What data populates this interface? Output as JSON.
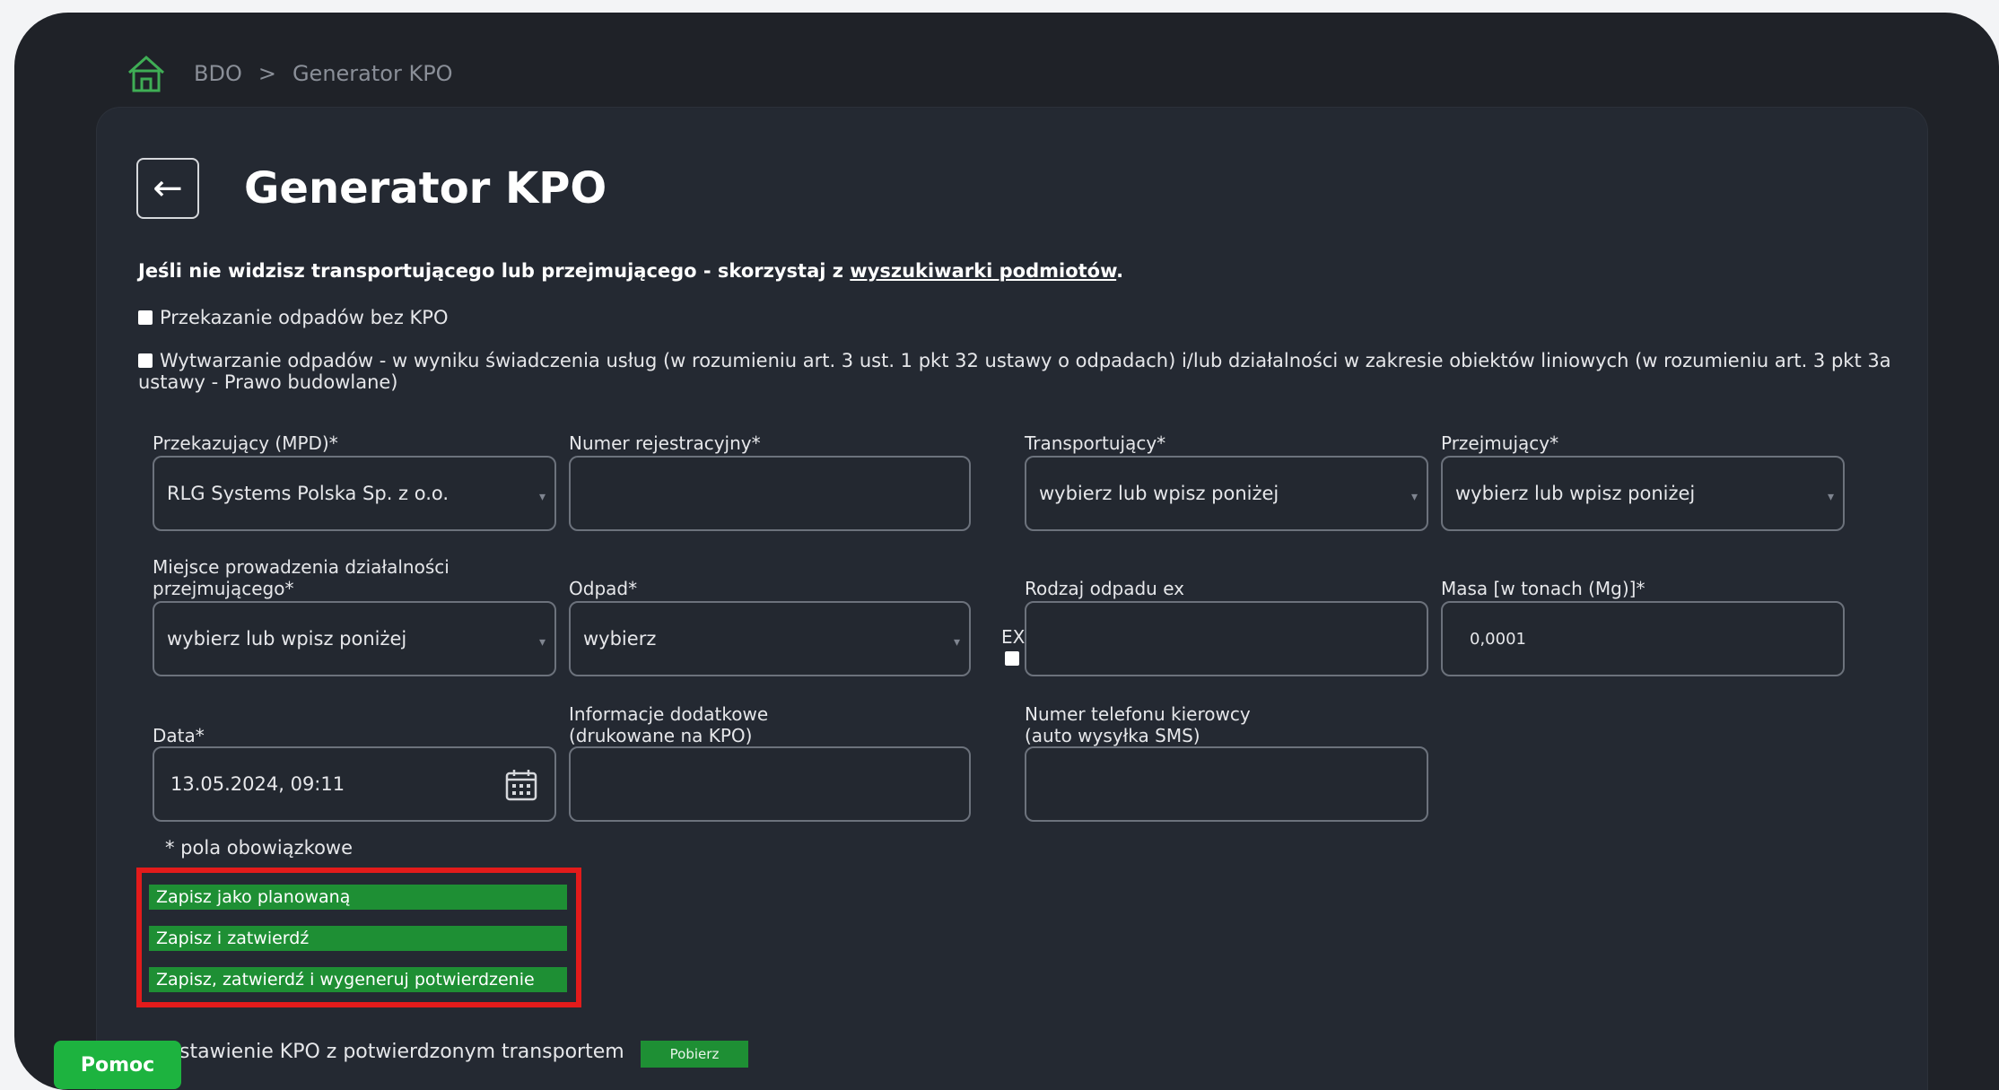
{
  "breadcrumb": {
    "root": "BDO",
    "separator": ">",
    "current": "Generator KPO"
  },
  "page": {
    "title": "Generator KPO",
    "info_prefix": "Jeśli nie widzisz transportującego lub przejmującego - skorzystaj z ",
    "info_link": "wyszukiwarki podmiotów",
    "info_suffix": ".",
    "checkbox1": "Przekazanie odpadów bez KPO",
    "checkbox2": "Wytwarzanie odpadów - w wyniku świadczenia usług (w rozumieniu art. 3 ust. 1 pkt 32 ustawy o odpadach) i/lub działalności w zakresie obiektów liniowych (w rozumieniu art. 3 pkt 3a ustawy - Prawo budowlane)"
  },
  "form": {
    "przekazujacy_label": "Przekazujący (MPD)*",
    "przekazujacy_value": "RLG Systems Polska Sp. z o.o.",
    "numer_rej_label": "Numer rejestracyjny*",
    "transportujacy_label": "Transportujący*",
    "transportujacy_value": "wybierz lub wpisz poniżej",
    "przejmujacy_label": "Przejmujący*",
    "przejmujacy_value": "wybierz lub wpisz poniżej",
    "miejsce_label_1": "Miejsce prowadzenia działalności",
    "miejsce_label_2": "przejmującego*",
    "miejsce_value": "wybierz lub wpisz poniżej",
    "odpad_label": "Odpad*",
    "odpad_value": "wybierz",
    "ex_label": "EX",
    "rodzaj_label": "Rodzaj odpadu ex",
    "masa_label": "Masa [w tonach (Mg)]*",
    "masa_value": "0,0001",
    "data_label": "Data*",
    "data_value": "13.05.2024, 09:11",
    "info_dod_label_1": "Informacje dodatkowe",
    "info_dod_label_2": "(drukowane na KPO)",
    "telefon_label_1": "Numer telefonu kierowcy",
    "telefon_label_2": "(auto wysyłka SMS)",
    "required_note": "* pola obowiązkowe"
  },
  "actions": {
    "save_planned": "Zapisz jako planowaną",
    "save_confirm": "Zapisz i zatwierdź",
    "save_confirm_generate": "Zapisz, zatwierdź i wygeneruj potwierdzenie"
  },
  "bottom": {
    "text": "stawienie KPO z potwierdzonym transportem",
    "download": "Pobierz",
    "help": "Pomoc"
  },
  "colors": {
    "background": "#1f2228",
    "accent_green": "#1e8f34",
    "highlight_red": "#e31b1b"
  }
}
